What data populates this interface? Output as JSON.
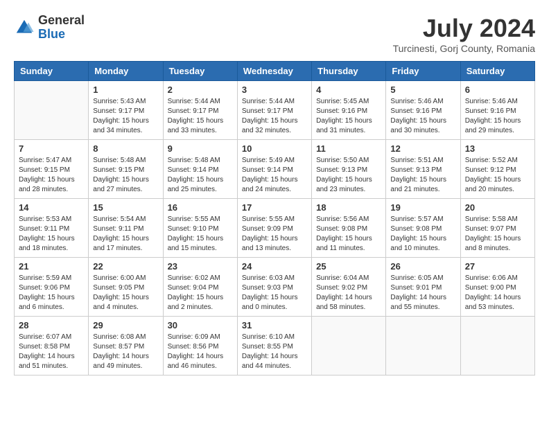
{
  "header": {
    "logo_general": "General",
    "logo_blue": "Blue",
    "title": "July 2024",
    "location": "Turcinesti, Gorj County, Romania"
  },
  "calendar": {
    "days_of_week": [
      "Sunday",
      "Monday",
      "Tuesday",
      "Wednesday",
      "Thursday",
      "Friday",
      "Saturday"
    ],
    "weeks": [
      [
        {
          "day": "",
          "info": ""
        },
        {
          "day": "1",
          "info": "Sunrise: 5:43 AM\nSunset: 9:17 PM\nDaylight: 15 hours\nand 34 minutes."
        },
        {
          "day": "2",
          "info": "Sunrise: 5:44 AM\nSunset: 9:17 PM\nDaylight: 15 hours\nand 33 minutes."
        },
        {
          "day": "3",
          "info": "Sunrise: 5:44 AM\nSunset: 9:17 PM\nDaylight: 15 hours\nand 32 minutes."
        },
        {
          "day": "4",
          "info": "Sunrise: 5:45 AM\nSunset: 9:16 PM\nDaylight: 15 hours\nand 31 minutes."
        },
        {
          "day": "5",
          "info": "Sunrise: 5:46 AM\nSunset: 9:16 PM\nDaylight: 15 hours\nand 30 minutes."
        },
        {
          "day": "6",
          "info": "Sunrise: 5:46 AM\nSunset: 9:16 PM\nDaylight: 15 hours\nand 29 minutes."
        }
      ],
      [
        {
          "day": "7",
          "info": "Sunrise: 5:47 AM\nSunset: 9:15 PM\nDaylight: 15 hours\nand 28 minutes."
        },
        {
          "day": "8",
          "info": "Sunrise: 5:48 AM\nSunset: 9:15 PM\nDaylight: 15 hours\nand 27 minutes."
        },
        {
          "day": "9",
          "info": "Sunrise: 5:48 AM\nSunset: 9:14 PM\nDaylight: 15 hours\nand 25 minutes."
        },
        {
          "day": "10",
          "info": "Sunrise: 5:49 AM\nSunset: 9:14 PM\nDaylight: 15 hours\nand 24 minutes."
        },
        {
          "day": "11",
          "info": "Sunrise: 5:50 AM\nSunset: 9:13 PM\nDaylight: 15 hours\nand 23 minutes."
        },
        {
          "day": "12",
          "info": "Sunrise: 5:51 AM\nSunset: 9:13 PM\nDaylight: 15 hours\nand 21 minutes."
        },
        {
          "day": "13",
          "info": "Sunrise: 5:52 AM\nSunset: 9:12 PM\nDaylight: 15 hours\nand 20 minutes."
        }
      ],
      [
        {
          "day": "14",
          "info": "Sunrise: 5:53 AM\nSunset: 9:11 PM\nDaylight: 15 hours\nand 18 minutes."
        },
        {
          "day": "15",
          "info": "Sunrise: 5:54 AM\nSunset: 9:11 PM\nDaylight: 15 hours\nand 17 minutes."
        },
        {
          "day": "16",
          "info": "Sunrise: 5:55 AM\nSunset: 9:10 PM\nDaylight: 15 hours\nand 15 minutes."
        },
        {
          "day": "17",
          "info": "Sunrise: 5:55 AM\nSunset: 9:09 PM\nDaylight: 15 hours\nand 13 minutes."
        },
        {
          "day": "18",
          "info": "Sunrise: 5:56 AM\nSunset: 9:08 PM\nDaylight: 15 hours\nand 11 minutes."
        },
        {
          "day": "19",
          "info": "Sunrise: 5:57 AM\nSunset: 9:08 PM\nDaylight: 15 hours\nand 10 minutes."
        },
        {
          "day": "20",
          "info": "Sunrise: 5:58 AM\nSunset: 9:07 PM\nDaylight: 15 hours\nand 8 minutes."
        }
      ],
      [
        {
          "day": "21",
          "info": "Sunrise: 5:59 AM\nSunset: 9:06 PM\nDaylight: 15 hours\nand 6 minutes."
        },
        {
          "day": "22",
          "info": "Sunrise: 6:00 AM\nSunset: 9:05 PM\nDaylight: 15 hours\nand 4 minutes."
        },
        {
          "day": "23",
          "info": "Sunrise: 6:02 AM\nSunset: 9:04 PM\nDaylight: 15 hours\nand 2 minutes."
        },
        {
          "day": "24",
          "info": "Sunrise: 6:03 AM\nSunset: 9:03 PM\nDaylight: 15 hours\nand 0 minutes."
        },
        {
          "day": "25",
          "info": "Sunrise: 6:04 AM\nSunset: 9:02 PM\nDaylight: 14 hours\nand 58 minutes."
        },
        {
          "day": "26",
          "info": "Sunrise: 6:05 AM\nSunset: 9:01 PM\nDaylight: 14 hours\nand 55 minutes."
        },
        {
          "day": "27",
          "info": "Sunrise: 6:06 AM\nSunset: 9:00 PM\nDaylight: 14 hours\nand 53 minutes."
        }
      ],
      [
        {
          "day": "28",
          "info": "Sunrise: 6:07 AM\nSunset: 8:58 PM\nDaylight: 14 hours\nand 51 minutes."
        },
        {
          "day": "29",
          "info": "Sunrise: 6:08 AM\nSunset: 8:57 PM\nDaylight: 14 hours\nand 49 minutes."
        },
        {
          "day": "30",
          "info": "Sunrise: 6:09 AM\nSunset: 8:56 PM\nDaylight: 14 hours\nand 46 minutes."
        },
        {
          "day": "31",
          "info": "Sunrise: 6:10 AM\nSunset: 8:55 PM\nDaylight: 14 hours\nand 44 minutes."
        },
        {
          "day": "",
          "info": ""
        },
        {
          "day": "",
          "info": ""
        },
        {
          "day": "",
          "info": ""
        }
      ]
    ]
  }
}
